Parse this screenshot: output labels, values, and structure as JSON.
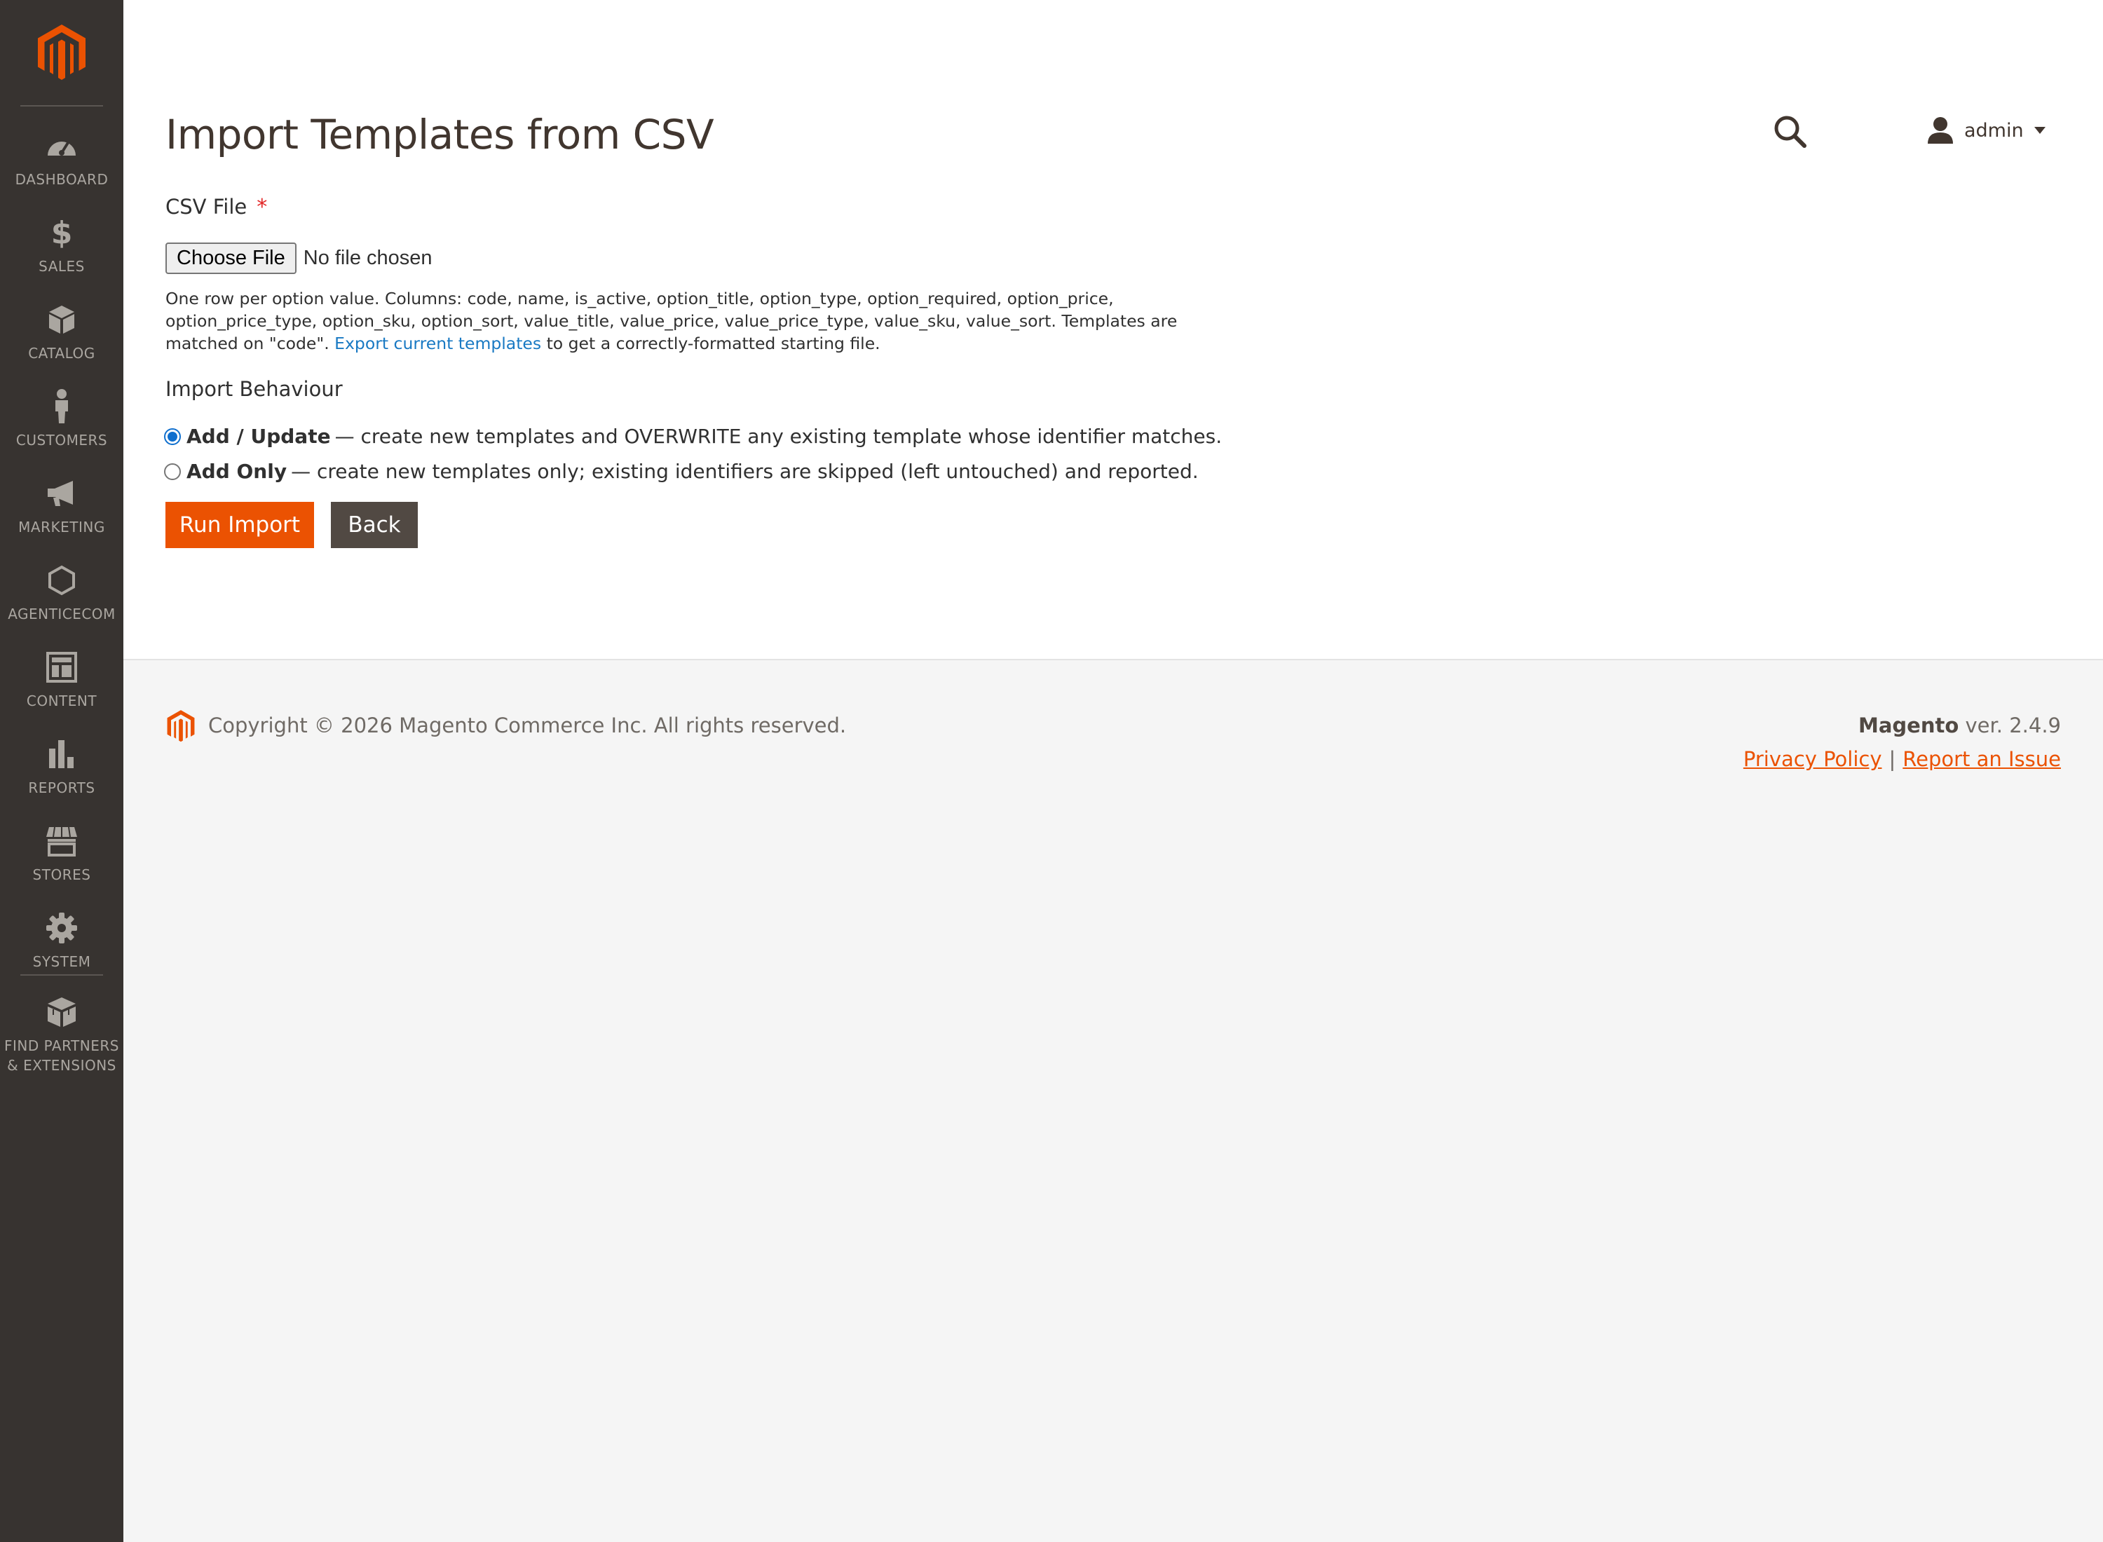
{
  "sidebar": {
    "logo": "magento-logo",
    "items": [
      {
        "label": "DASHBOARD",
        "icon": "dashboard-icon"
      },
      {
        "label": "SALES",
        "icon": "dollar-icon"
      },
      {
        "label": "CATALOG",
        "icon": "box-icon"
      },
      {
        "label": "CUSTOMERS",
        "icon": "person-icon"
      },
      {
        "label": "MARKETING",
        "icon": "megaphone-icon"
      },
      {
        "label": "AGENTICECOM",
        "icon": "hexagon-icon"
      },
      {
        "label": "CONTENT",
        "icon": "layout-icon"
      },
      {
        "label": "REPORTS",
        "icon": "bar-chart-icon"
      },
      {
        "label": "STORES",
        "icon": "store-icon"
      },
      {
        "label": "SYSTEM",
        "icon": "gear-icon"
      },
      {
        "label": "FIND PARTNERS & EXTENSIONS",
        "label_line1": "FIND PARTNERS",
        "label_line2": "& EXTENSIONS",
        "icon": "blocks-icon"
      }
    ]
  },
  "header": {
    "title": "Import Templates from CSV",
    "user": "admin"
  },
  "form": {
    "csv_label": "CSV File",
    "required_mark": "*",
    "choose_file": "Choose File",
    "file_status": "No file chosen",
    "help_text_before": "One row per option value. Columns: code, name, is_active, option_title, option_type, option_required, option_price, option_price_type, option_sku, option_sort, value_title, value_price, value_price_type, value_sku, value_sort. Templates are matched on \"code\". ",
    "help_link": "Export current templates",
    "help_text_after": " to get a correctly-formatted starting file.",
    "behaviour_title": "Import Behaviour",
    "options": [
      {
        "title": "Add / Update",
        "desc": "— create new templates and OVERWRITE any existing template whose identifier matches.",
        "checked": true
      },
      {
        "title": "Add Only",
        "desc": "— create new templates only; existing identifiers are skipped (left untouched) and reported.",
        "checked": false
      }
    ],
    "run_button": "Run Import",
    "back_button": "Back"
  },
  "footer": {
    "copyright": "Copyright © 2026 Magento Commerce Inc. All rights reserved.",
    "brand": "Magento",
    "version": " ver. 2.4.9",
    "privacy": "Privacy Policy",
    "separator": "|",
    "report": "Report an Issue"
  },
  "colors": {
    "sidebar_bg": "#373330",
    "accent": "#eb5202",
    "secondary_button": "#514943",
    "link": "#1979c3"
  }
}
